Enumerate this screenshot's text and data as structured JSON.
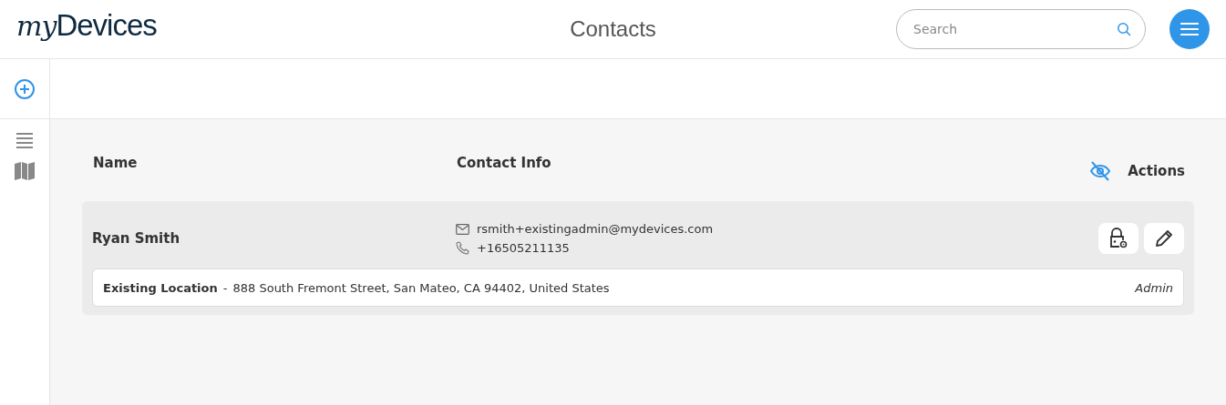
{
  "header": {
    "logo": {
      "script": "my",
      "text": "Devices"
    },
    "title": "Contacts",
    "search": {
      "placeholder": "Search"
    }
  },
  "sidebar": {
    "items": [
      {
        "kind": "add"
      },
      {
        "kind": "list"
      },
      {
        "kind": "map"
      }
    ]
  },
  "table": {
    "columns": [
      "Name",
      "Contact Info",
      "Actions"
    ],
    "rows": [
      {
        "name": "Ryan Smith",
        "email": "rsmith+existingadmin@mydevices.com",
        "phone": "+16505211135",
        "location": "Existing Location",
        "separator": "-",
        "address": "888 South Fremont Street, San Mateo, CA 94402, United States",
        "role": "Admin"
      }
    ]
  }
}
